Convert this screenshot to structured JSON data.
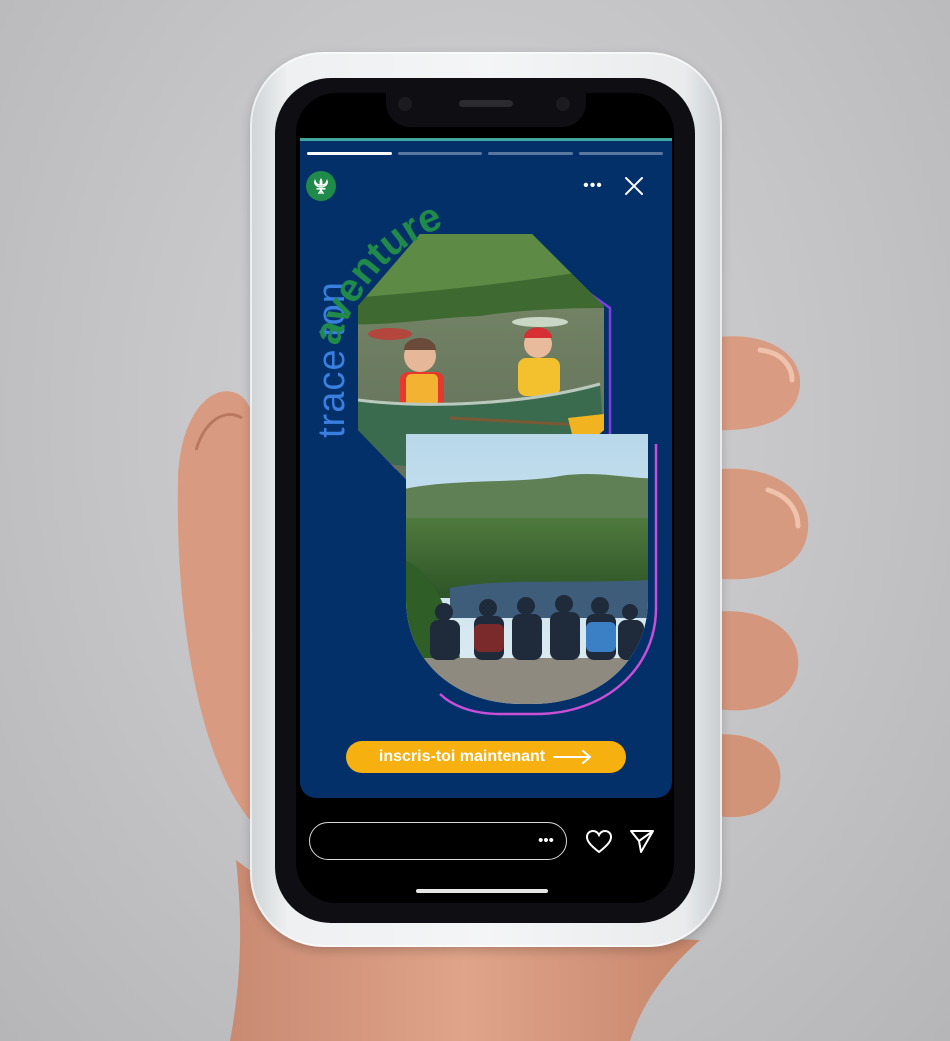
{
  "story": {
    "headline_light": "trace ton",
    "headline_bold": "aventure",
    "progress": {
      "segments": 4,
      "current": 1
    },
    "cta": {
      "label": "inscris-toi maintenant"
    }
  },
  "header": {
    "avatar_icon": "fleur-de-lis-icon",
    "more_icon": "more-dots-icon",
    "close_icon": "close-icon"
  },
  "footer": {
    "reply_more_icon": "more-dots-icon",
    "like_icon": "heart-icon",
    "share_icon": "send-icon"
  },
  "colors": {
    "story_background": "#033069",
    "headline_light": "#3a7fe0",
    "headline_bold": "#1f8a4a",
    "cta_background": "#f6b00f",
    "outline_purple": "#7b3fe4",
    "outline_pink": "#c94fd6",
    "top_accent": "#3fa6a0"
  }
}
